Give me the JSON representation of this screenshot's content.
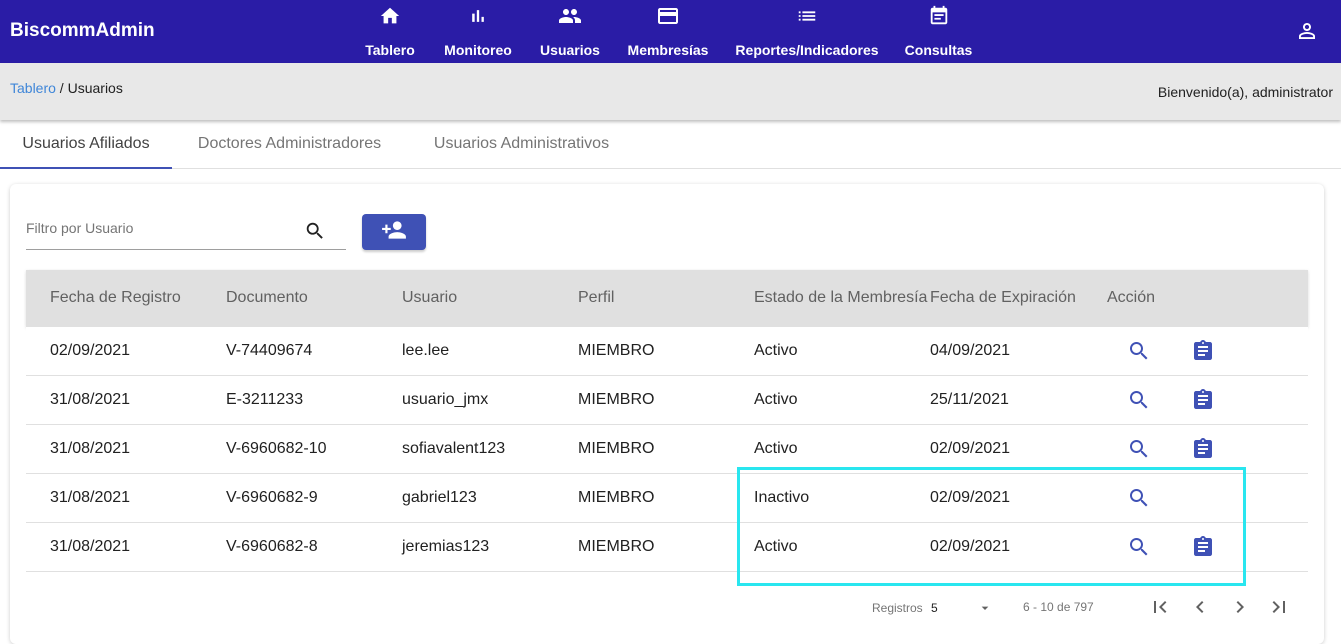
{
  "app": {
    "brand": "BiscommAdmin"
  },
  "nav": {
    "items": [
      {
        "label": "Tablero",
        "icon": "home-icon"
      },
      {
        "label": "Monitoreo",
        "icon": "bar-chart-icon"
      },
      {
        "label": "Usuarios",
        "icon": "people-icon"
      },
      {
        "label": "Membresías",
        "icon": "credit-card-icon"
      },
      {
        "label": "Reportes/Indicadores",
        "icon": "list-icon"
      },
      {
        "label": "Consultas",
        "icon": "event-note-icon"
      }
    ],
    "user_icon": "account-icon"
  },
  "breadcrumb": {
    "link": "Tablero",
    "separator": " / ",
    "current": "Usuarios"
  },
  "welcome": "Bienvenido(a), administrator",
  "tabs": [
    {
      "label": "Usuarios Afiliados",
      "active": true
    },
    {
      "label": "Doctores Administradores",
      "active": false
    },
    {
      "label": "Usuarios Administrativos",
      "active": false
    }
  ],
  "filter": {
    "placeholder": "Filtro por Usuario",
    "value": ""
  },
  "table": {
    "headers": [
      "Fecha de Registro",
      "Documento",
      "Usuario",
      "Perfil",
      "Estado de la Membresía",
      "Fecha de Expiración",
      "Acción"
    ],
    "rows": [
      {
        "fecha": "02/09/2021",
        "documento": "V-74409674",
        "usuario": "lee.lee",
        "perfil": "MIEMBRO",
        "estado": "Activo",
        "expiracion": "04/09/2021",
        "has_membership_action": true
      },
      {
        "fecha": "31/08/2021",
        "documento": "E-3211233",
        "usuario": "usuario_jmx",
        "perfil": "MIEMBRO",
        "estado": "Activo",
        "expiracion": "25/11/2021",
        "has_membership_action": true
      },
      {
        "fecha": "31/08/2021",
        "documento": "V-6960682-10",
        "usuario": "sofiavalent123",
        "perfil": "MIEMBRO",
        "estado": "Activo",
        "expiracion": "02/09/2021",
        "has_membership_action": true
      },
      {
        "fecha": "31/08/2021",
        "documento": "V-6960682-9",
        "usuario": "gabriel123",
        "perfil": "MIEMBRO",
        "estado": "Inactivo",
        "expiracion": "02/09/2021",
        "has_membership_action": false
      },
      {
        "fecha": "31/08/2021",
        "documento": "V-6960682-8",
        "usuario": "jeremias123",
        "perfil": "MIEMBRO",
        "estado": "Activo",
        "expiracion": "02/09/2021",
        "has_membership_action": true
      }
    ]
  },
  "pager": {
    "label": "Registros",
    "page_size": "5",
    "range": "6 - 10 de 797"
  },
  "colors": {
    "primary": "#2a1ca6",
    "accent": "#3f51b5",
    "link": "#3f86d8",
    "highlight": "#29e6ef"
  }
}
